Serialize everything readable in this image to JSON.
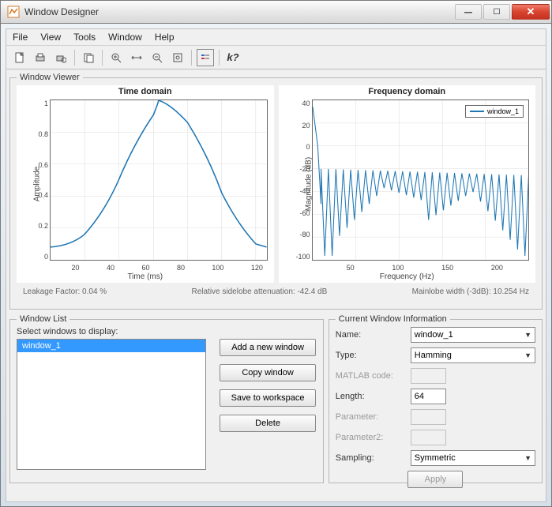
{
  "window": {
    "title": "Window Designer"
  },
  "menu": {
    "items": [
      "File",
      "View",
      "Tools",
      "Window",
      "Help"
    ]
  },
  "viewer": {
    "legend_title": "Window Viewer",
    "time_chart": {
      "title": "Time domain",
      "xlabel": "Time (ms)",
      "ylabel": "Amplitude"
    },
    "freq_chart": {
      "title": "Frequency domain",
      "xlabel": "Frequency (Hz)",
      "ylabel": "Magnitude (dB)",
      "legend": "window_1"
    },
    "stats": {
      "leakage": "Leakage Factor: 0.04 %",
      "sidelobe": "Relative sidelobe attenuation: -42.4 dB",
      "mainlobe": "Mainlobe width (-3dB): 10.254 Hz"
    }
  },
  "winlist": {
    "legend_title": "Window List",
    "instruction": "Select windows to display:",
    "items": [
      "window_1"
    ],
    "buttons": {
      "add": "Add a new window",
      "copy": "Copy window",
      "save": "Save to workspace",
      "delete": "Delete"
    }
  },
  "info": {
    "legend_title": "Current Window Information",
    "labels": {
      "name": "Name:",
      "type": "Type:",
      "matlab": "MATLAB code:",
      "length": "Length:",
      "param": "Parameter:",
      "param2": "Parameter2:",
      "sampling": "Sampling:"
    },
    "values": {
      "name": "window_1",
      "type": "Hamming",
      "length": "64",
      "sampling": "Symmetric"
    },
    "apply": "Apply"
  },
  "chart_data": [
    {
      "type": "line",
      "title": "Time domain",
      "xlabel": "Time (ms)",
      "ylabel": "Amplitude",
      "xlim": [
        0,
        126
      ],
      "ylim": [
        0,
        1
      ],
      "xticks": [
        20,
        40,
        60,
        80,
        100,
        120
      ],
      "yticks": [
        0,
        0.2,
        0.4,
        0.6,
        0.8,
        1
      ],
      "series": [
        {
          "name": "window_1",
          "x": [
            0,
            10,
            20,
            30,
            40,
            50,
            60,
            63,
            70,
            80,
            90,
            100,
            110,
            120,
            126
          ],
          "y": [
            0.08,
            0.13,
            0.28,
            0.5,
            0.73,
            0.91,
            0.99,
            1.0,
            0.98,
            0.86,
            0.65,
            0.42,
            0.22,
            0.1,
            0.08
          ]
        }
      ]
    },
    {
      "type": "line",
      "title": "Frequency domain",
      "xlabel": "Frequency (Hz)",
      "ylabel": "Magnitude (dB)",
      "xlim": [
        0,
        250
      ],
      "ylim": [
        -100,
        40
      ],
      "xticks": [
        50,
        100,
        150,
        200
      ],
      "yticks": [
        -100,
        -80,
        -60,
        -40,
        -20,
        0,
        20,
        40
      ],
      "legend_position": "top-right",
      "series": [
        {
          "name": "window_1",
          "note": "Main lobe peak ~34 dB at 0 Hz dropping to sidelobes oscillating between approx -20 and -90 dB with ~28 lobes across 0-250 Hz",
          "mainlobe_peak_db": 34,
          "first_sidelobe_db": -42.4,
          "sidelobe_envelope_top_db": [
            -20,
            -25
          ],
          "sidelobe_envelope_bottom_db": [
            -95,
            -60,
            -95
          ],
          "approx_lobe_count": 28
        }
      ]
    }
  ]
}
